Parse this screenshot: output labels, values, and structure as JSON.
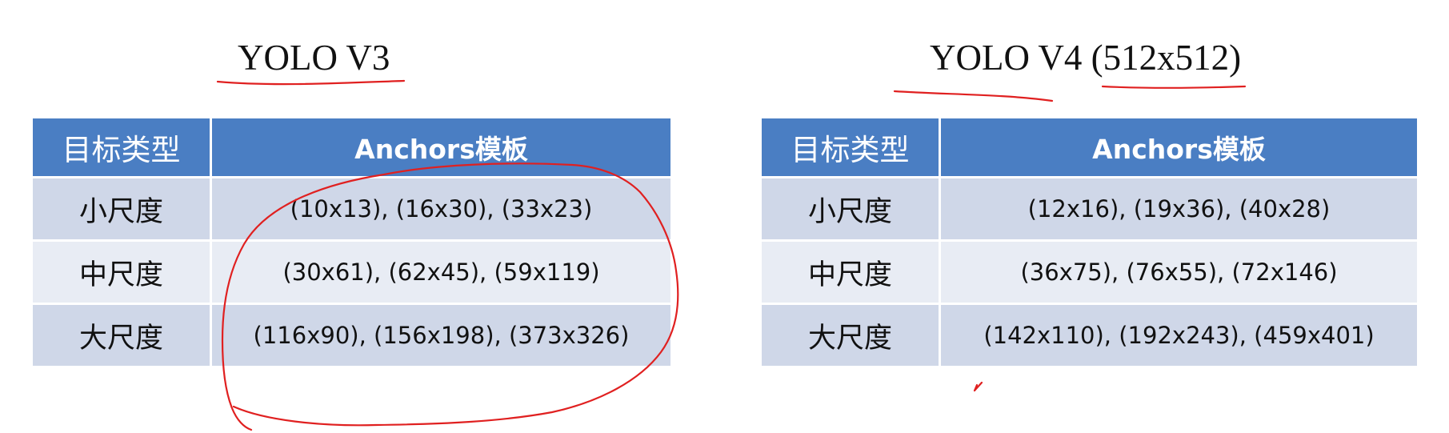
{
  "left": {
    "title": "YOLO V3",
    "headers": {
      "type": "目标类型",
      "anchors": "Anchors模板"
    },
    "rows": [
      {
        "type": "小尺度",
        "anchors": "(10x13), (16x30), (33x23)"
      },
      {
        "type": "中尺度",
        "anchors": "(30x61), (62x45), (59x119)"
      },
      {
        "type": "大尺度",
        "anchors": "(116x90), (156x198), (373x326)"
      }
    ]
  },
  "right": {
    "title": "YOLO V4 (512x512)",
    "headers": {
      "type": "目标类型",
      "anchors": "Anchors模板"
    },
    "rows": [
      {
        "type": "小尺度",
        "anchors": "(12x16), (19x36), (40x28)"
      },
      {
        "type": "中尺度",
        "anchors": "(36x75), (76x55), (72x146)"
      },
      {
        "type": "大尺度",
        "anchors": "(142x110), (192x243), (459x401)"
      }
    ]
  },
  "colors": {
    "header_bg": "#4a7ec3",
    "row_odd_bg": "#cfd7e8",
    "row_even_bg": "#e8ecf4",
    "annotation_ink": "#e02020"
  }
}
